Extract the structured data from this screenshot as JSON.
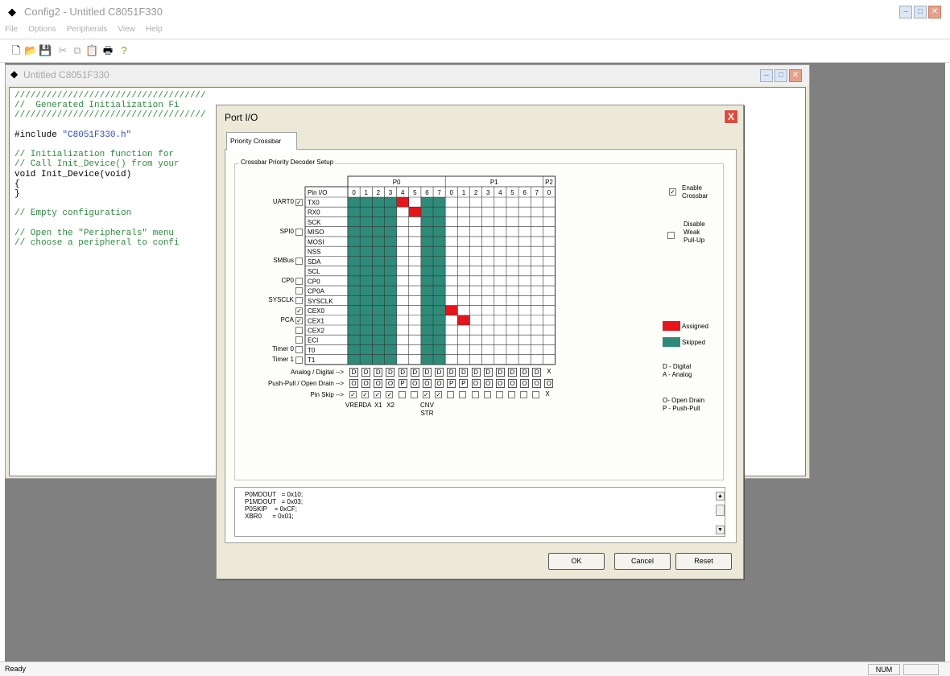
{
  "app": {
    "title": "Config2 - Untitled C8051F330",
    "menu": [
      "File",
      "Options",
      "Peripherals",
      "View",
      "Help"
    ]
  },
  "child_window": {
    "title": "Untitled C8051F330",
    "code_lines": [
      {
        "text": "////////////////////////////////////",
        "class": "cmt"
      },
      {
        "text": "//  Generated Initialization Fi",
        "class": "cmt"
      },
      {
        "text": "////////////////////////////////////",
        "class": "cmt"
      },
      {
        "text": "",
        "class": ""
      },
      {
        "text": "#include \"C8051F330.h\"",
        "class": "inc"
      },
      {
        "text": "",
        "class": ""
      },
      {
        "text": "// Initialization function for",
        "class": "cmt"
      },
      {
        "text": "// Call Init_Device() from your",
        "class": "cmt"
      },
      {
        "text": "void Init_Device(void)",
        "class": ""
      },
      {
        "text": "{",
        "class": ""
      },
      {
        "text": "}",
        "class": ""
      },
      {
        "text": "",
        "class": ""
      },
      {
        "text": "// Empty configuration",
        "class": "cmt"
      },
      {
        "text": "",
        "class": ""
      },
      {
        "text": "// Open the \"Peripherals\" menu",
        "class": "cmt"
      },
      {
        "text": "// choose a peripheral to confi",
        "class": "cmt"
      }
    ]
  },
  "dialog": {
    "title": "Port I/O",
    "close_glyph": "X",
    "tab_label": "Priority Crossbar",
    "group_label": "Crossbar Priority Decoder Setup",
    "ports": [
      "P0",
      "P1",
      "P2"
    ],
    "pin_io_label": "Pin I/O",
    "pin_numbers": [
      "0",
      "1",
      "2",
      "3",
      "4",
      "5",
      "6",
      "7",
      "0",
      "1",
      "2",
      "3",
      "4",
      "5",
      "6",
      "7",
      "0"
    ],
    "signals": [
      "TX0",
      "RX0",
      "SCK",
      "MISO",
      "MOSI",
      "NSS",
      "SDA",
      "SCL",
      "CP0",
      "CP0A",
      "SYSCLK",
      "CEX0",
      "CEX1",
      "CEX2",
      "ECI",
      "T0",
      "T1"
    ],
    "skipped_pins": [
      0,
      1,
      2,
      3,
      6,
      7
    ],
    "assigned": [
      {
        "signal": 0,
        "pin": 4
      },
      {
        "signal": 1,
        "pin": 5
      },
      {
        "signal": 11,
        "pin": 8
      },
      {
        "signal": 12,
        "pin": 9
      }
    ],
    "peripherals": [
      {
        "label": "UART0",
        "checked": true,
        "row": 0
      },
      {
        "label": "SPI0",
        "checked": false,
        "row": 3
      },
      {
        "label": "SMBus",
        "checked": false,
        "row": 6
      },
      {
        "label": "CP0",
        "checked": false,
        "row": 8
      },
      {
        "label": "",
        "checked": false,
        "row": 9
      },
      {
        "label": "SYSCLK",
        "checked": false,
        "row": 10
      },
      {
        "label": "",
        "checked": true,
        "row": 11
      },
      {
        "label": "PCA",
        "checked": true,
        "row": 12
      },
      {
        "label": "",
        "checked": false,
        "row": 13
      },
      {
        "label": "",
        "checked": false,
        "row": 14
      },
      {
        "label": "Timer 0",
        "checked": false,
        "row": 15
      },
      {
        "label": "Timer 1",
        "checked": false,
        "row": 16
      }
    ],
    "enable_crossbar": {
      "label1": "Enable",
      "label2": "Crossbar",
      "checked": true
    },
    "disable_weak_pullup": {
      "label1": "Disable",
      "label2": "Weak",
      "label3": "Pull-Up",
      "checked": false
    },
    "legend": {
      "assigned": "Assigned",
      "skipped": "Skipped",
      "digital": "D - Digital",
      "analog": "A - Analog",
      "open_drain": "O- Open Drain",
      "push_pull": "P - Push-Pull"
    },
    "analog_digital_label": "Analog / Digital -->",
    "analog_digital": [
      "D",
      "D",
      "D",
      "D",
      "D",
      "D",
      "D",
      "D",
      "D",
      "D",
      "D",
      "D",
      "D",
      "D",
      "D",
      "D",
      "X"
    ],
    "pushpull_label": "Push-Pull / Open Drain -->",
    "pushpull": [
      "O",
      "O",
      "O",
      "O",
      "P",
      "O",
      "O",
      "O",
      "P",
      "P",
      "O",
      "O",
      "O",
      "O",
      "O",
      "O",
      "O"
    ],
    "pinskip_label": "Pin Skip -->",
    "pinskip": [
      true,
      true,
      true,
      true,
      false,
      false,
      true,
      true,
      false,
      false,
      false,
      false,
      false,
      false,
      false,
      false,
      null
    ],
    "pinskip_x": "X",
    "pin_notes": [
      {
        "pin": 0,
        "text": "VREF"
      },
      {
        "pin": 1,
        "text": "IDA"
      },
      {
        "pin": 2,
        "text": "X1"
      },
      {
        "pin": 3,
        "text": "X2"
      },
      {
        "pin": 6,
        "text": "CNV"
      }
    ],
    "pin_note_6b": "STR",
    "code_output": [
      "P0MDOUT   = 0x10;",
      "P1MDOUT   = 0x03;",
      "P0SKIP    = 0xCF;",
      "XBR0      = 0x01;"
    ],
    "buttons": {
      "ok": "OK",
      "cancel": "Cancel",
      "reset": "Reset"
    },
    "colors": {
      "assigned": "#e8141c",
      "skipped": "#2e8b7a"
    }
  },
  "status": {
    "text": "Ready",
    "num": "NUM"
  }
}
